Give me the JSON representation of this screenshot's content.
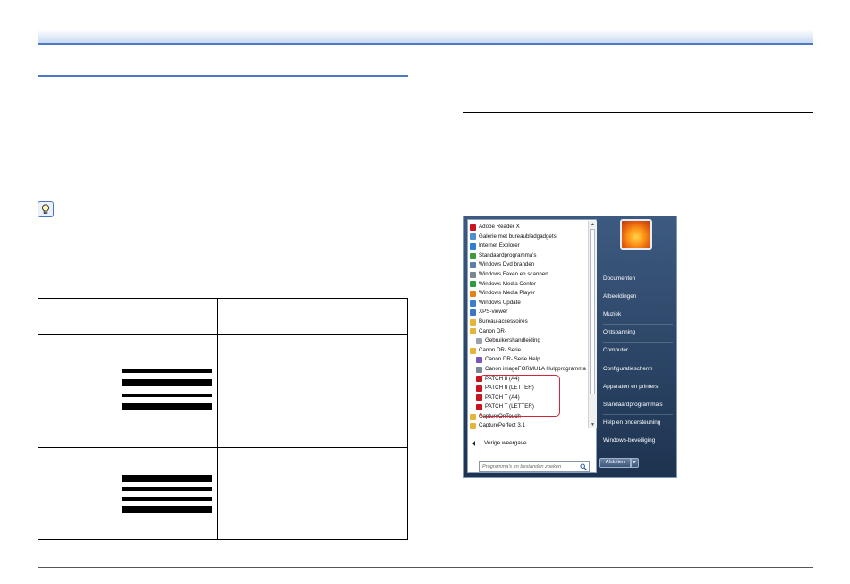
{
  "start_menu": {
    "programs": [
      {
        "label": "Adobe Reader X",
        "icon": "pdf-red-icon",
        "level": 0,
        "color": "#c8141e"
      },
      {
        "label": "Galerie met bureaubladgadgets",
        "icon": "gadget-gallery-icon",
        "level": 0,
        "color": "#4e8fd0"
      },
      {
        "label": "Internet Explorer",
        "icon": "internet-explorer-icon",
        "level": 0,
        "color": "#2d7fd3"
      },
      {
        "label": "Standaardprogramma's",
        "icon": "default-programs-icon",
        "level": 0,
        "color": "#3f9a3a"
      },
      {
        "label": "Windows Dvd branden",
        "icon": "dvd-icon",
        "level": 0,
        "color": "#5a7fa8"
      },
      {
        "label": "Windows Faxen en scannen",
        "icon": "fax-scan-icon",
        "level": 0,
        "color": "#7a8794"
      },
      {
        "label": "Windows Media Center",
        "icon": "media-center-icon",
        "level": 0,
        "color": "#2f9b3e"
      },
      {
        "label": "Windows Media Player",
        "icon": "media-player-icon",
        "level": 0,
        "color": "#e2831b"
      },
      {
        "label": "Windows Update",
        "icon": "windows-update-icon",
        "level": 0,
        "color": "#3a7fc8"
      },
      {
        "label": "XPS-viewer",
        "icon": "xps-viewer-icon",
        "level": 0,
        "color": "#3b78c4"
      },
      {
        "label": "Bureau-accessoires",
        "icon": "folder-icon",
        "level": 0,
        "color": "#e3b53a"
      },
      {
        "label": "Canon DR-",
        "icon": "folder-icon",
        "level": 0,
        "color": "#e3b53a"
      },
      {
        "label": "Gebruikershandleiding",
        "icon": "document-icon",
        "level": 1,
        "color": "#9aa3ad"
      },
      {
        "label": "Canon DR-       Serie",
        "icon": "folder-icon",
        "level": 0,
        "color": "#e3b53a"
      },
      {
        "label": "Canon DR-       Serie Help",
        "icon": "help-icon",
        "level": 1,
        "color": "#7a56b8"
      },
      {
        "label": "Canon imageFORMULA Hulpprogramma",
        "icon": "utility-icon",
        "level": 1,
        "color": "#7a8794"
      },
      {
        "label": "PATCH II (A4)",
        "icon": "pdf-icon",
        "level": 1,
        "color": "#c8141e"
      },
      {
        "label": "PATCH II (LETTER)",
        "icon": "pdf-icon",
        "level": 1,
        "color": "#c8141e"
      },
      {
        "label": "PATCH T (A4)",
        "icon": "pdf-icon",
        "level": 1,
        "color": "#c8141e"
      },
      {
        "label": "PATCH T (LETTER)",
        "icon": "pdf-icon",
        "level": 1,
        "color": "#c8141e"
      },
      {
        "label": "CaptureOnTouch",
        "icon": "folder-icon",
        "level": 0,
        "color": "#e3b53a"
      },
      {
        "label": "CapturePerfect 3.1",
        "icon": "folder-icon",
        "level": 0,
        "color": "#e3b53a"
      }
    ],
    "back_label": "Vorige weergave",
    "search_placeholder": "Programma's en bestanden zoeken",
    "right_items": [
      "Documenten",
      "Afbeeldingen",
      "Muziek",
      "Ontspanning",
      "Computer",
      "Configuratiescherm",
      "Apparaten en printers",
      "Standaardprogramma's",
      "Help en ondersteuning",
      "Windows-beveiliging"
    ],
    "shutdown_label": "Afsluiten",
    "highlight_color": "#d0253a"
  }
}
